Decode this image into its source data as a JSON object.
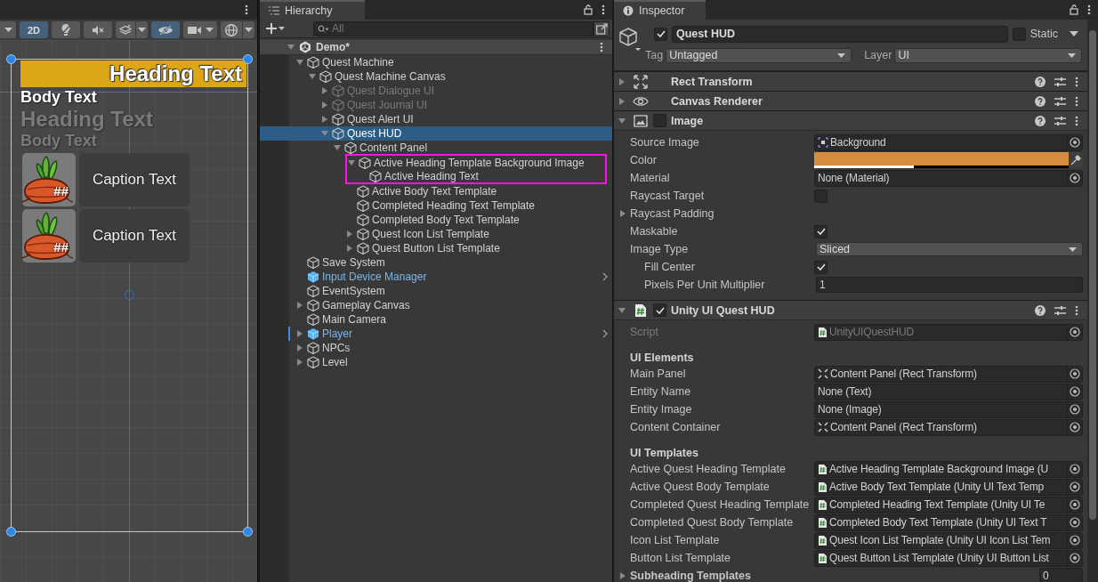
{
  "scene_view": {
    "toolbar": [
      {
        "kind": "dropdown",
        "selected": false
      },
      {
        "kind": "label",
        "label": "2D",
        "selected": true
      },
      {
        "kind": "lighting",
        "selected": false
      },
      {
        "kind": "audio",
        "selected": false
      },
      {
        "kind": "effects",
        "selected": false
      },
      {
        "kind": "visibility",
        "selected": true
      },
      {
        "kind": "camera",
        "selected": false
      },
      {
        "kind": "gizmos",
        "selected": false
      }
    ],
    "texts": [
      {
        "kind": "active_heading",
        "text": "Heading Text"
      },
      {
        "kind": "active_body",
        "text": "Body Text"
      },
      {
        "kind": "completed_heading",
        "text": "Heading Text"
      },
      {
        "kind": "completed_body",
        "text": "Body Text"
      }
    ],
    "icon_rows": [
      {
        "badge": "##",
        "caption": "Caption Text"
      },
      {
        "badge": "##",
        "caption": "Caption Text"
      }
    ]
  },
  "hierarchy": {
    "title": "Hierarchy",
    "search": {
      "placeholder": "All"
    },
    "scene": {
      "name": "Demo*",
      "expanded": true
    },
    "items": [
      {
        "name": "Quest Machine",
        "expanded": true,
        "selected": false,
        "disabled": false,
        "prefab": false,
        "highlighted": false,
        "overridden": false,
        "children": [
          {
            "name": "Quest Machine Canvas",
            "expanded": true,
            "selected": false,
            "disabled": false,
            "prefab": false,
            "highlighted": false,
            "overridden": false,
            "children": [
              {
                "name": "Quest Dialogue UI",
                "expanded": false,
                "selected": false,
                "disabled": true,
                "prefab": false,
                "highlighted": false,
                "overridden": false
              },
              {
                "name": "Quest Journal UI",
                "expanded": false,
                "selected": false,
                "disabled": true,
                "prefab": false,
                "highlighted": false,
                "overridden": false
              },
              {
                "name": "Quest Alert UI",
                "expanded": false,
                "selected": false,
                "disabled": false,
                "prefab": false,
                "highlighted": false,
                "overridden": false
              },
              {
                "name": "Quest HUD",
                "expanded": true,
                "selected": true,
                "disabled": false,
                "prefab": false,
                "highlighted": false,
                "overridden": false,
                "children": [
                  {
                    "name": "Content Panel",
                    "expanded": true,
                    "selected": false,
                    "disabled": false,
                    "prefab": false,
                    "highlighted": false,
                    "overridden": false,
                    "children": [
                      {
                        "name": "Active Heading Template Background Image",
                        "expanded": true,
                        "selected": false,
                        "disabled": false,
                        "prefab": false,
                        "highlighted": true,
                        "overridden": false,
                        "children": [
                          {
                            "name": "Active Heading Text",
                            "selected": false,
                            "disabled": false,
                            "prefab": false,
                            "highlighted": false,
                            "overridden": false
                          }
                        ]
                      },
                      {
                        "name": "Active Body Text Template",
                        "selected": false,
                        "disabled": false,
                        "prefab": false,
                        "highlighted": false,
                        "overridden": false
                      },
                      {
                        "name": "Completed Heading Text Template",
                        "selected": false,
                        "disabled": false,
                        "prefab": false,
                        "highlighted": false,
                        "overridden": false
                      },
                      {
                        "name": "Completed Body Text Template",
                        "selected": false,
                        "disabled": false,
                        "prefab": false,
                        "highlighted": false,
                        "overridden": false
                      },
                      {
                        "name": "Quest Icon List Template",
                        "expanded": false,
                        "selected": false,
                        "disabled": false,
                        "prefab": false,
                        "highlighted": false,
                        "overridden": false
                      },
                      {
                        "name": "Quest Button List Template",
                        "expanded": false,
                        "selected": false,
                        "disabled": false,
                        "prefab": false,
                        "highlighted": false,
                        "overridden": false
                      }
                    ]
                  }
                ]
              }
            ]
          }
        ]
      },
      {
        "name": "Save System",
        "selected": false,
        "disabled": false,
        "prefab": false,
        "highlighted": false,
        "overridden": false
      },
      {
        "name": "Input Device Manager",
        "selected": false,
        "disabled": false,
        "prefab": true,
        "highlighted": false,
        "overridden": false
      },
      {
        "name": "EventSystem",
        "selected": false,
        "disabled": false,
        "prefab": false,
        "highlighted": false,
        "overridden": false
      },
      {
        "name": "Gameplay Canvas",
        "expanded": false,
        "selected": false,
        "disabled": false,
        "prefab": false,
        "highlighted": false,
        "overridden": false
      },
      {
        "name": "Main Camera",
        "selected": false,
        "disabled": false,
        "prefab": false,
        "highlighted": false,
        "overridden": false
      },
      {
        "name": "Player",
        "expanded": false,
        "selected": false,
        "disabled": false,
        "prefab": true,
        "highlighted": false,
        "overridden": true
      },
      {
        "name": "NPCs",
        "expanded": false,
        "selected": false,
        "disabled": false,
        "prefab": false,
        "highlighted": false,
        "overridden": false
      },
      {
        "name": "Level",
        "expanded": false,
        "selected": false,
        "disabled": false,
        "prefab": false,
        "highlighted": false,
        "overridden": false
      }
    ]
  },
  "inspector": {
    "title": "Inspector",
    "object": {
      "active": true,
      "name": "Quest HUD",
      "static": false,
      "static_label": "Static",
      "tag_label": "Tag",
      "tag": "Untagged",
      "layer_label": "Layer",
      "layer": "UI"
    },
    "components": [
      {
        "kind": "rect_transform",
        "name": "Rect Transform",
        "expanded": false
      },
      {
        "kind": "canvas_renderer",
        "name": "Canvas Renderer",
        "expanded": false
      },
      {
        "kind": "image",
        "name": "Image",
        "expanded": true,
        "enabled": false,
        "properties": [
          {
            "kind": "sprite_field",
            "label": "Source Image",
            "value": "Background"
          },
          {
            "kind": "color",
            "label": "Color",
            "color": "#d68c3f",
            "level": 0.39
          },
          {
            "kind": "object_field",
            "label": "Material",
            "value": "None (Material)"
          },
          {
            "kind": "checkbox",
            "label": "Raycast Target",
            "checked": false
          },
          {
            "kind": "foldout",
            "label": "Raycast Padding",
            "expanded": false
          },
          {
            "kind": "checkbox",
            "label": "Maskable",
            "checked": true
          },
          {
            "kind": "dropdown",
            "label": "Image Type",
            "value": "Sliced",
            "children": [
              {
                "kind": "checkbox",
                "label": "Fill Center",
                "checked": true
              },
              {
                "kind": "number",
                "label": "Pixels Per Unit Multiplier",
                "value": "1"
              }
            ]
          }
        ]
      },
      {
        "kind": "script",
        "name": "Unity UI Quest HUD",
        "expanded": true,
        "enabled": true,
        "properties": [
          {
            "kind": "script_field",
            "label": "Script",
            "value": "UnityUIQuestHUD",
            "disabled": true
          },
          {
            "kind": "header",
            "label": "UI Elements"
          },
          {
            "kind": "rect_field",
            "label": "Main Panel",
            "value": "Content Panel (Rect Transform)"
          },
          {
            "kind": "object_field",
            "label": "Entity Name",
            "value": "None (Text)"
          },
          {
            "kind": "object_field",
            "label": "Entity Image",
            "value": "None (Image)"
          },
          {
            "kind": "rect_field",
            "label": "Content Container",
            "value": "Content Panel (Rect Transform)"
          },
          {
            "kind": "header",
            "label": "UI Templates"
          },
          {
            "kind": "script_field",
            "label": "Active Quest Heading Template",
            "value": "Active Heading Template Background Image (U",
            "disabled": false
          },
          {
            "kind": "script_field",
            "label": "Active Quest Body Template",
            "value": "Active Body Text Template (Unity UI Text Temp",
            "disabled": false
          },
          {
            "kind": "script_field",
            "label": "Completed Quest Heading Template",
            "value": "Completed Heading Text Template (Unity UI Te",
            "disabled": false
          },
          {
            "kind": "script_field",
            "label": "Completed Quest Body Template",
            "value": "Completed Body Text Template (Unity UI Text T",
            "disabled": false
          },
          {
            "kind": "script_field",
            "label": "Icon List Template",
            "value": "Quest Icon List Template (Unity UI Icon List Tem",
            "disabled": false
          },
          {
            "kind": "script_field",
            "label": "Button List Template",
            "value": "Quest Button List Template (Unity UI Button List",
            "disabled": false
          },
          {
            "kind": "array",
            "label": "Subheading Templates",
            "value": "0",
            "expanded": false
          }
        ]
      }
    ]
  }
}
